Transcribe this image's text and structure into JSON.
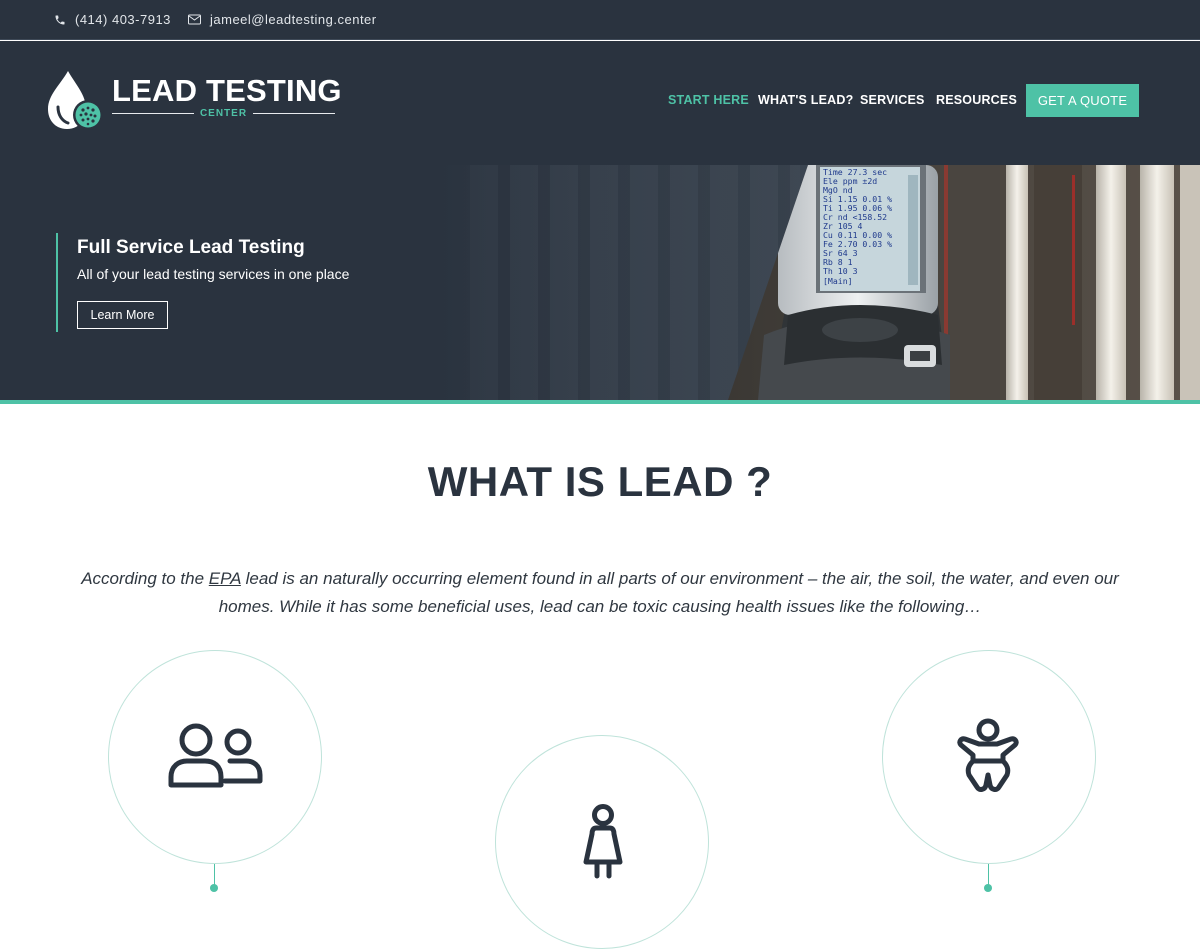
{
  "topbar": {
    "phone": "(414) 403-7913",
    "email": "jameel@leadtesting.center",
    "phone_icon": "phone-icon",
    "email_icon": "envelope-icon"
  },
  "brand": {
    "name": "LEAD TESTING",
    "tagline": "CENTER"
  },
  "nav": {
    "items": [
      {
        "label": "START HERE",
        "active": true
      },
      {
        "label": "WHAT'S LEAD?"
      },
      {
        "label": "SERVICES"
      },
      {
        "label": "RESOURCES"
      }
    ],
    "cta": "GET A QUOTE"
  },
  "hero": {
    "heading": "Full Service Lead Testing",
    "subheading": "All of your lead testing services in one place",
    "button": "Learn More",
    "device_screen": [
      "Time 27.3 sec",
      "Ele    ppm   ±2d",
      "MgO     nd",
      "Si    1.15  0.01 %",
      "Ti    1.95  0.06 %",
      "Cr      nd <158.52",
      "Zr    105     4",
      "Cu    0.11  0.00 %",
      "Fe    2.70  0.03 %",
      "Sr     64     3",
      "Rb      8     1",
      "Th     10     3",
      "[Main]"
    ]
  },
  "section": {
    "title": "WHAT IS LEAD ?",
    "intro_before_link": "According to the ",
    "intro_link": "EPA",
    "intro_after_link": " lead is an naturally occurring element found in all parts of our environment – the air, the soil, the water, and even our homes. While it has some beneficial uses, lead can be toxic causing health issues like the following…"
  },
  "icons": [
    "people-icon",
    "woman-icon",
    "baby-icon"
  ],
  "colors": {
    "dark": "#2a333f",
    "accent": "#4ec2a6",
    "white": "#ffffff"
  }
}
